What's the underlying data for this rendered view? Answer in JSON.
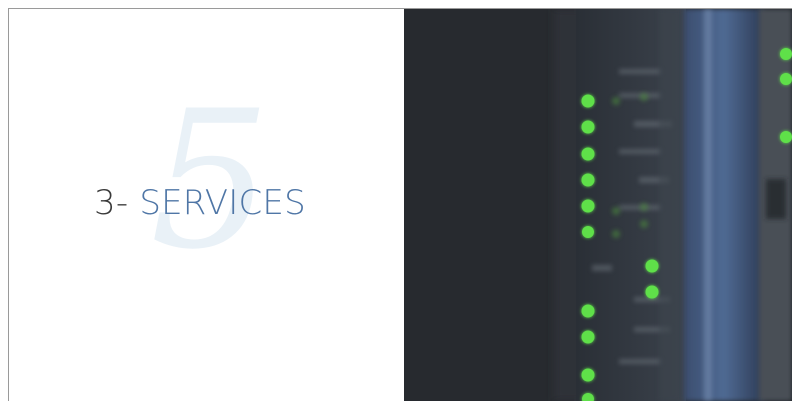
{
  "slide": {
    "section_number": "3-",
    "section_title": "SERVICES",
    "background_numeral": "5"
  },
  "image": {
    "description_icon": "server-rack-photo",
    "led_color": "#5fe04a"
  },
  "colors": {
    "title_blue": "#4f76a6",
    "title_gray": "#3a3a3a",
    "numeral_tint": "#e9f1f7",
    "frame": "#9a9a9a"
  }
}
